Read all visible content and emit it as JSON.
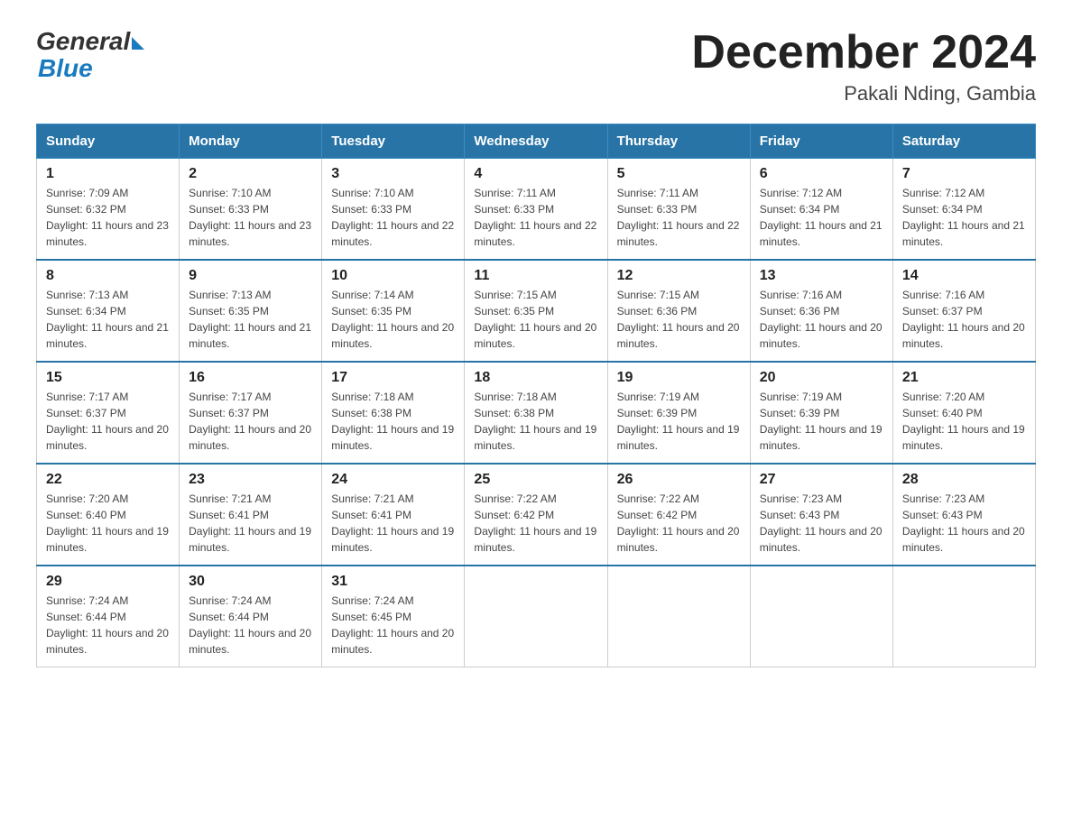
{
  "header": {
    "logo_general": "General",
    "logo_blue": "Blue",
    "title": "December 2024",
    "subtitle": "Pakali Nding, Gambia"
  },
  "weekdays": [
    "Sunday",
    "Monday",
    "Tuesday",
    "Wednesday",
    "Thursday",
    "Friday",
    "Saturday"
  ],
  "weeks": [
    [
      {
        "day": "1",
        "sunrise": "7:09 AM",
        "sunset": "6:32 PM",
        "daylight": "11 hours and 23 minutes."
      },
      {
        "day": "2",
        "sunrise": "7:10 AM",
        "sunset": "6:33 PM",
        "daylight": "11 hours and 23 minutes."
      },
      {
        "day": "3",
        "sunrise": "7:10 AM",
        "sunset": "6:33 PM",
        "daylight": "11 hours and 22 minutes."
      },
      {
        "day": "4",
        "sunrise": "7:11 AM",
        "sunset": "6:33 PM",
        "daylight": "11 hours and 22 minutes."
      },
      {
        "day": "5",
        "sunrise": "7:11 AM",
        "sunset": "6:33 PM",
        "daylight": "11 hours and 22 minutes."
      },
      {
        "day": "6",
        "sunrise": "7:12 AM",
        "sunset": "6:34 PM",
        "daylight": "11 hours and 21 minutes."
      },
      {
        "day": "7",
        "sunrise": "7:12 AM",
        "sunset": "6:34 PM",
        "daylight": "11 hours and 21 minutes."
      }
    ],
    [
      {
        "day": "8",
        "sunrise": "7:13 AM",
        "sunset": "6:34 PM",
        "daylight": "11 hours and 21 minutes."
      },
      {
        "day": "9",
        "sunrise": "7:13 AM",
        "sunset": "6:35 PM",
        "daylight": "11 hours and 21 minutes."
      },
      {
        "day": "10",
        "sunrise": "7:14 AM",
        "sunset": "6:35 PM",
        "daylight": "11 hours and 20 minutes."
      },
      {
        "day": "11",
        "sunrise": "7:15 AM",
        "sunset": "6:35 PM",
        "daylight": "11 hours and 20 minutes."
      },
      {
        "day": "12",
        "sunrise": "7:15 AM",
        "sunset": "6:36 PM",
        "daylight": "11 hours and 20 minutes."
      },
      {
        "day": "13",
        "sunrise": "7:16 AM",
        "sunset": "6:36 PM",
        "daylight": "11 hours and 20 minutes."
      },
      {
        "day": "14",
        "sunrise": "7:16 AM",
        "sunset": "6:37 PM",
        "daylight": "11 hours and 20 minutes."
      }
    ],
    [
      {
        "day": "15",
        "sunrise": "7:17 AM",
        "sunset": "6:37 PM",
        "daylight": "11 hours and 20 minutes."
      },
      {
        "day": "16",
        "sunrise": "7:17 AM",
        "sunset": "6:37 PM",
        "daylight": "11 hours and 20 minutes."
      },
      {
        "day": "17",
        "sunrise": "7:18 AM",
        "sunset": "6:38 PM",
        "daylight": "11 hours and 19 minutes."
      },
      {
        "day": "18",
        "sunrise": "7:18 AM",
        "sunset": "6:38 PM",
        "daylight": "11 hours and 19 minutes."
      },
      {
        "day": "19",
        "sunrise": "7:19 AM",
        "sunset": "6:39 PM",
        "daylight": "11 hours and 19 minutes."
      },
      {
        "day": "20",
        "sunrise": "7:19 AM",
        "sunset": "6:39 PM",
        "daylight": "11 hours and 19 minutes."
      },
      {
        "day": "21",
        "sunrise": "7:20 AM",
        "sunset": "6:40 PM",
        "daylight": "11 hours and 19 minutes."
      }
    ],
    [
      {
        "day": "22",
        "sunrise": "7:20 AM",
        "sunset": "6:40 PM",
        "daylight": "11 hours and 19 minutes."
      },
      {
        "day": "23",
        "sunrise": "7:21 AM",
        "sunset": "6:41 PM",
        "daylight": "11 hours and 19 minutes."
      },
      {
        "day": "24",
        "sunrise": "7:21 AM",
        "sunset": "6:41 PM",
        "daylight": "11 hours and 19 minutes."
      },
      {
        "day": "25",
        "sunrise": "7:22 AM",
        "sunset": "6:42 PM",
        "daylight": "11 hours and 19 minutes."
      },
      {
        "day": "26",
        "sunrise": "7:22 AM",
        "sunset": "6:42 PM",
        "daylight": "11 hours and 20 minutes."
      },
      {
        "day": "27",
        "sunrise": "7:23 AM",
        "sunset": "6:43 PM",
        "daylight": "11 hours and 20 minutes."
      },
      {
        "day": "28",
        "sunrise": "7:23 AM",
        "sunset": "6:43 PM",
        "daylight": "11 hours and 20 minutes."
      }
    ],
    [
      {
        "day": "29",
        "sunrise": "7:24 AM",
        "sunset": "6:44 PM",
        "daylight": "11 hours and 20 minutes."
      },
      {
        "day": "30",
        "sunrise": "7:24 AM",
        "sunset": "6:44 PM",
        "daylight": "11 hours and 20 minutes."
      },
      {
        "day": "31",
        "sunrise": "7:24 AM",
        "sunset": "6:45 PM",
        "daylight": "11 hours and 20 minutes."
      },
      null,
      null,
      null,
      null
    ]
  ]
}
